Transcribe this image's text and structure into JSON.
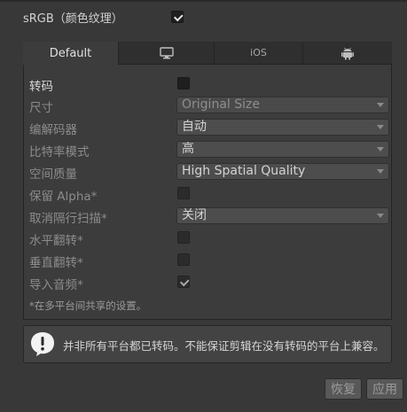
{
  "srgb": {
    "label": "sRGB（颜色纹理）",
    "checked": true
  },
  "tabs": [
    {
      "label": "Default",
      "icon": "default-tab",
      "active": true
    },
    {
      "label": "",
      "icon": "monitor-icon",
      "active": false
    },
    {
      "label": "iOS",
      "icon": "ios-tab",
      "active": false
    },
    {
      "label": "",
      "icon": "android-icon",
      "active": false
    }
  ],
  "settings": {
    "transcode": {
      "label": "转码",
      "checked": false
    },
    "size": {
      "label": "尺寸",
      "value": "Original Size"
    },
    "codec": {
      "label": "编解码器",
      "value": "自动"
    },
    "bitrate": {
      "label": "比特率模式",
      "value": "高"
    },
    "spatial_quality": {
      "label": "空间质量",
      "value": "High Spatial Quality"
    },
    "keep_alpha": {
      "label": "保留 Alpha*",
      "checked": false
    },
    "deinterlace": {
      "label": "取消隔行扫描*",
      "value": "关闭"
    },
    "flip_h": {
      "label": "水平翻转*",
      "checked": false
    },
    "flip_v": {
      "label": "垂直翻转*",
      "checked": false
    },
    "import_audio": {
      "label": "导入音频*",
      "checked": true
    },
    "note": "*在多平台间共享的设置。"
  },
  "warning": {
    "text": "并非所有平台都已转码。不能保证剪辑在没有转码的平台上兼容。",
    "icon": "warning-icon"
  },
  "buttons": {
    "revert": "恢复",
    "apply": "应用"
  }
}
